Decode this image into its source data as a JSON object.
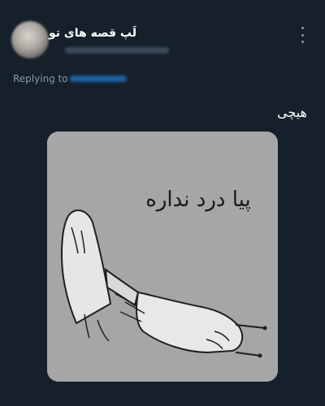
{
  "tweet": {
    "display_name": "لَپ قصه های تو",
    "replying_to_label": "Replying to",
    "text": "هیچی"
  },
  "media": {
    "caption": "پیا درد نداره"
  },
  "icons": {
    "more": "more-vertical-icon"
  },
  "colors": {
    "background": "#15202b",
    "primary_text": "#ffffff",
    "secondary_text": "#8899a6",
    "link": "#1d9bf0",
    "image_background": "#a6a6a6"
  }
}
